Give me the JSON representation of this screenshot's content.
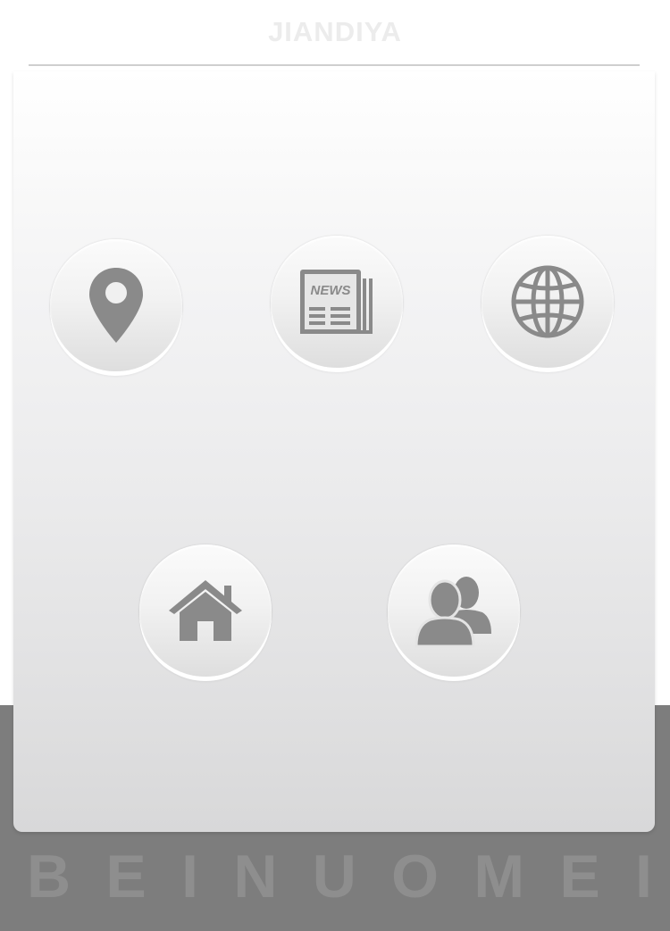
{
  "header": {
    "title": "JIANDIYA"
  },
  "menu": {
    "items": [
      {
        "icon": "map-pin-icon"
      },
      {
        "icon": "newspaper-icon",
        "icon_text": "NEWS"
      },
      {
        "icon": "globe-icon"
      },
      {
        "icon": "home-icon"
      },
      {
        "icon": "users-icon"
      }
    ]
  },
  "footer": {
    "brand_letters": [
      "B",
      "E",
      "I",
      "N",
      "U",
      "O",
      "M",
      "E",
      "I"
    ]
  },
  "colors": {
    "icon": "#8a8a8a",
    "footer_band": "#7d7d7d",
    "footer_text": "#8e8e8e",
    "header_title": "#ececec",
    "divider": "#cfcfcf"
  }
}
